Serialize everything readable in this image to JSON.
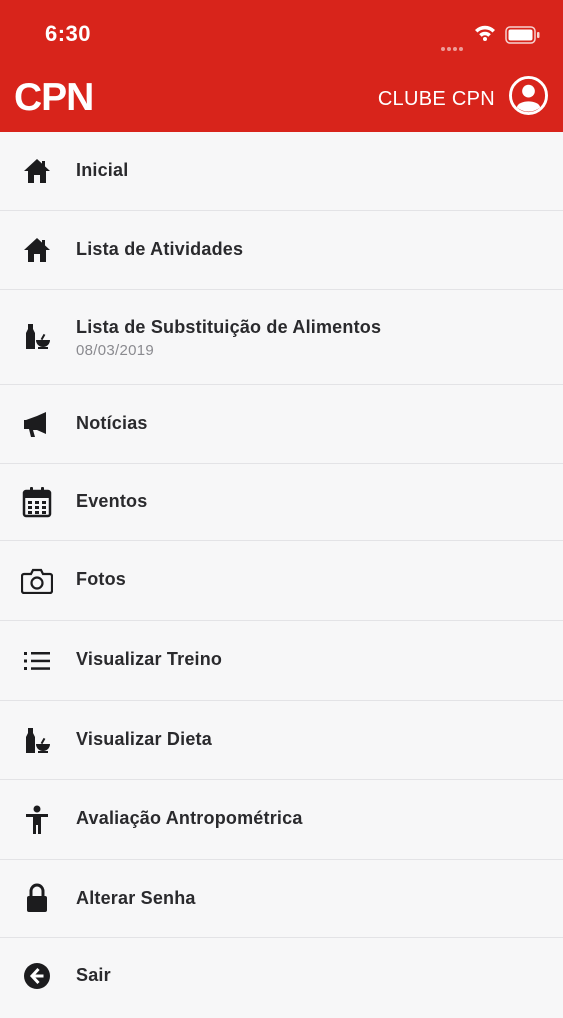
{
  "status_bar": {
    "time": "6:30"
  },
  "header": {
    "logo": "CPN",
    "club_label": "CLUBE CPN",
    "avatar_icon": "user-circle-icon"
  },
  "colors": {
    "header_bg": "#d8241b",
    "background": "#f7f7f8",
    "text": "#2a2a2d",
    "subtext": "#8a8a8f"
  },
  "menu": {
    "items": [
      {
        "label": "Inicial",
        "icon": "home-icon"
      },
      {
        "label": "Lista de Atividades",
        "icon": "home-icon"
      },
      {
        "label": "Lista de Substituição de Alimentos",
        "sub": "08/03/2019",
        "icon": "food-bottle-bowl-icon"
      },
      {
        "label": "Notícias",
        "icon": "megaphone-icon"
      },
      {
        "label": "Eventos",
        "icon": "calendar-icon"
      },
      {
        "label": "Fotos",
        "icon": "camera-icon"
      },
      {
        "label": "Visualizar Treino",
        "icon": "list-icon"
      },
      {
        "label": "Visualizar Dieta",
        "icon": "food-bottle-bowl-icon"
      },
      {
        "label": "Avaliação Antropométrica",
        "icon": "person-icon"
      },
      {
        "label": "Alterar Senha",
        "icon": "lock-icon"
      },
      {
        "label": "Sair",
        "icon": "back-arrow-icon"
      }
    ]
  }
}
